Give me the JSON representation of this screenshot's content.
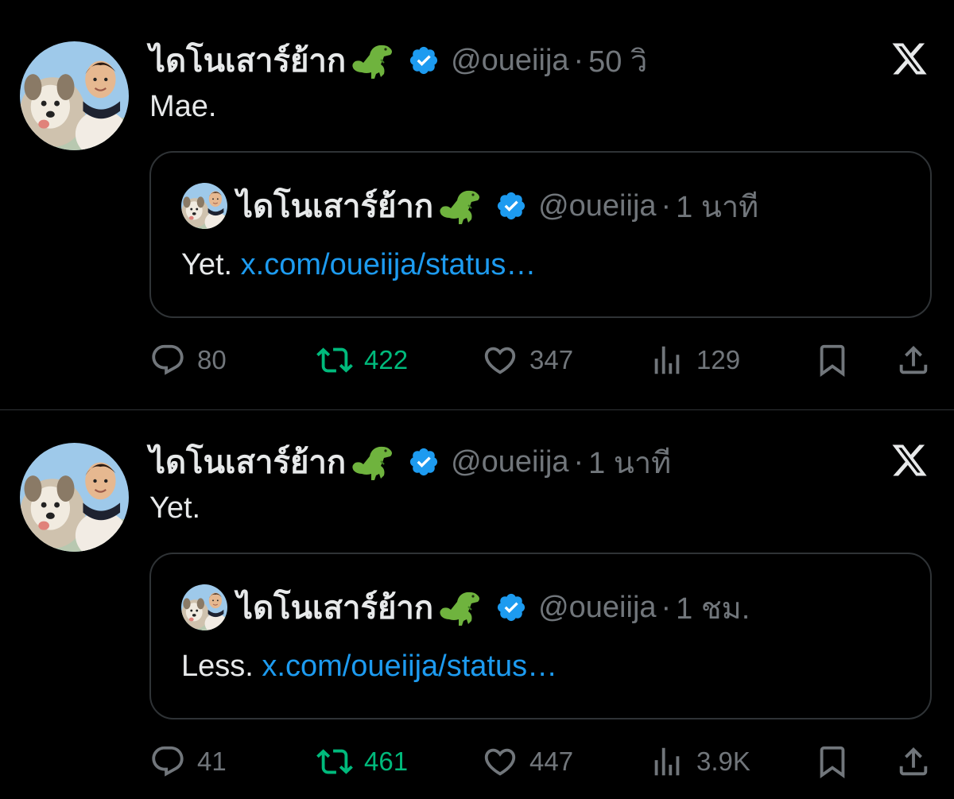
{
  "colors": {
    "background": "#000000",
    "text": "#e7e9ea",
    "muted": "#71767b",
    "link": "#1d9bf0",
    "retweet": "#00ba7c",
    "verified": "#1d9bf0",
    "border": "#2f3336"
  },
  "tweets": [
    {
      "author": {
        "name": "ไดโนเสาร์ย้าก",
        "emoji_icon": "t-rex-icon",
        "handle": "@oueiija",
        "verified": true
      },
      "separator": "·",
      "time": "50 วิ",
      "text": "Mae.",
      "quote": {
        "author": {
          "name": "ไดโนเสาร์ย้าก",
          "handle": "@oueiija"
        },
        "separator": "·",
        "time": "1 นาที",
        "text": "Yet.",
        "link": "x.com/oueiija/status…"
      },
      "stats": {
        "replies": "80",
        "retweets": "422",
        "likes": "347",
        "views": "129"
      }
    },
    {
      "author": {
        "name": "ไดโนเสาร์ย้าก",
        "emoji_icon": "t-rex-icon",
        "handle": "@oueiija",
        "verified": true
      },
      "separator": "·",
      "time": "1 นาที",
      "text": "Yet.",
      "quote": {
        "author": {
          "name": "ไดโนเสาร์ย้าก",
          "handle": "@oueiija"
        },
        "separator": "·",
        "time": "1 ชม.",
        "text": "Less.",
        "link": "x.com/oueiija/status…"
      },
      "stats": {
        "replies": "41",
        "retweets": "461",
        "likes": "447",
        "views": "3.9K"
      }
    }
  ]
}
